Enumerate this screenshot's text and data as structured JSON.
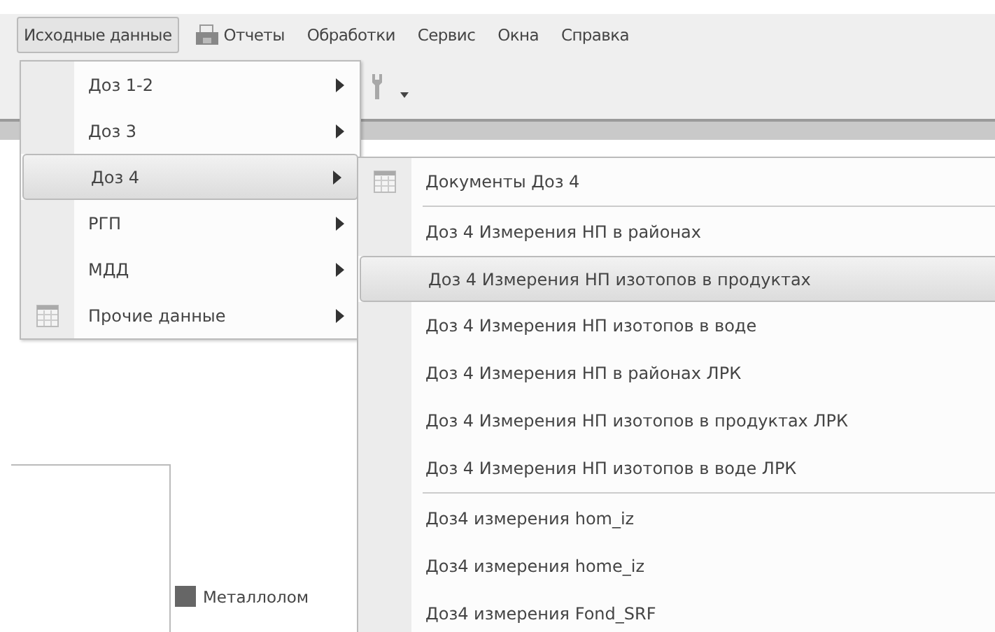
{
  "menu_bar": [
    {
      "label": "Исходные данные",
      "selected": true,
      "kind": "plain"
    },
    {
      "label": "Отчеты",
      "selected": false,
      "kind": "icon"
    },
    {
      "label": "Обработки",
      "selected": false,
      "kind": "plain"
    },
    {
      "label": "Сервис",
      "selected": false,
      "kind": "plain"
    },
    {
      "label": "Окна",
      "selected": false,
      "kind": "plain"
    },
    {
      "label": "Справка",
      "selected": false,
      "kind": "plain"
    }
  ],
  "dropdown": {
    "items": [
      {
        "label": "Доз 1-2",
        "selected": false,
        "kind": "plain"
      },
      {
        "label": "Доз 3",
        "selected": false,
        "kind": "plain"
      },
      {
        "label": "Доз 4",
        "selected": true,
        "kind": "plain"
      },
      {
        "label": "РГП",
        "selected": false,
        "kind": "plain"
      },
      {
        "label": "МДД",
        "selected": false,
        "kind": "plain"
      },
      {
        "label": "Прочие данные",
        "selected": false,
        "kind": "icon"
      }
    ]
  },
  "submenu": {
    "groups": [
      [
        {
          "label": "Документы Доз 4",
          "selected": false,
          "kind": "icon"
        }
      ],
      [
        {
          "label": "Доз 4 Измерения НП в районах",
          "selected": false,
          "kind": "plain"
        },
        {
          "label": "Доз 4 Измерения НП изотопов в продуктах",
          "selected": true,
          "kind": "plain"
        },
        {
          "label": "Доз 4 Измерения НП изотопов в воде",
          "selected": false,
          "kind": "plain"
        },
        {
          "label": "Доз 4 Измерения НП в районах ЛРК",
          "selected": false,
          "kind": "plain"
        },
        {
          "label": "Доз 4 Измерения НП изотопов в продуктах ЛРК",
          "selected": false,
          "kind": "plain"
        },
        {
          "label": "Доз 4 Измерения НП изотопов в воде ЛРК",
          "selected": false,
          "kind": "plain"
        }
      ],
      [
        {
          "label": "Доз4 измерения hom_iz",
          "selected": false,
          "kind": "plain"
        },
        {
          "label": "Доз4 измерения home_iz",
          "selected": false,
          "kind": "plain"
        },
        {
          "label": "Доз4 измерения Fond_SRF",
          "selected": false,
          "kind": "plain"
        }
      ]
    ]
  },
  "legend": {
    "label": "Металлолом",
    "color": "#666666"
  }
}
